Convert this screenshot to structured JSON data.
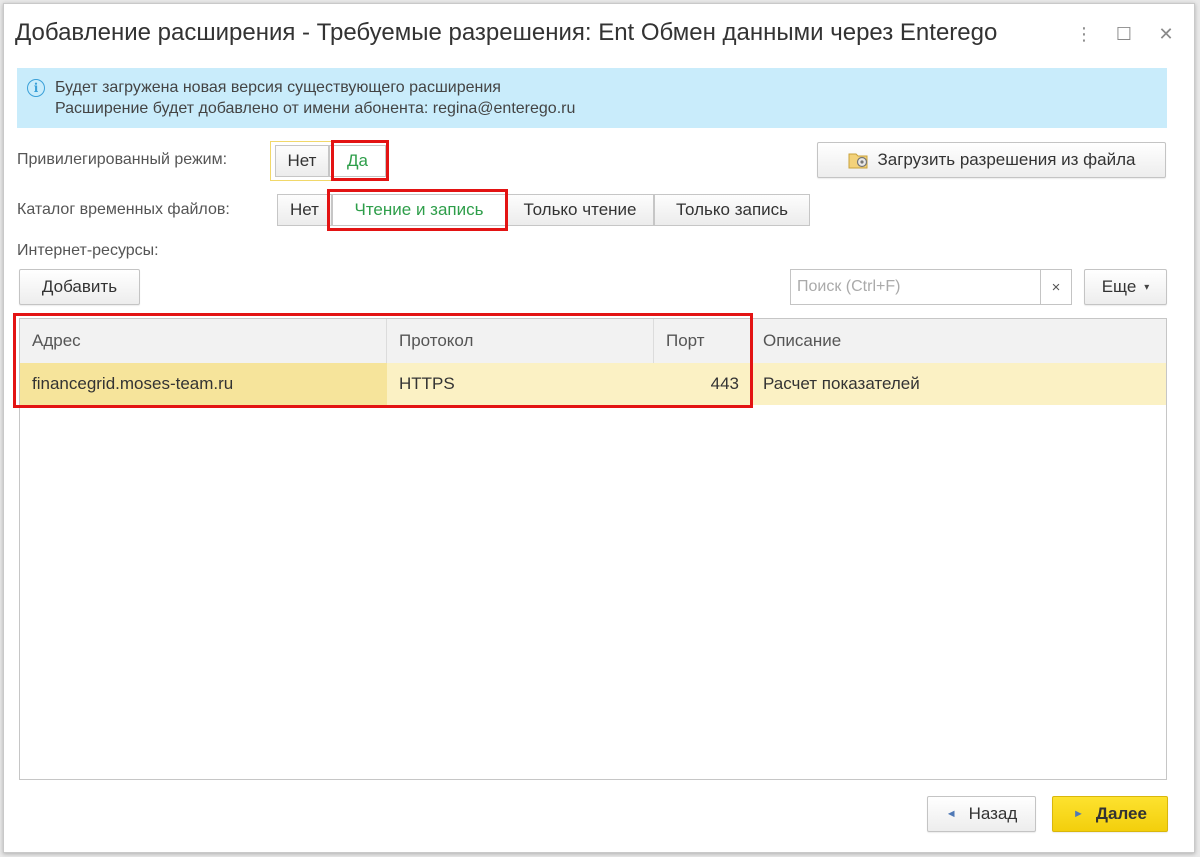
{
  "window": {
    "title": "Добавление расширения - Требуемые разрешения: Ent Обмен данными через Enterego",
    "more_icon": "⋮",
    "maximize_icon": "☐",
    "close_icon": "✕"
  },
  "info": {
    "line1": "Будет загружена новая версия существующего расширения",
    "line2": "Расширение будет добавлено от имени абонента: regina@enterego.ru"
  },
  "privileged": {
    "label": "Привилегированный режим:",
    "options": [
      "Нет",
      "Да"
    ],
    "selected": "Да"
  },
  "load_button": {
    "label": "Загрузить разрешения из файла"
  },
  "temp_catalog": {
    "label": "Каталог временных файлов:",
    "options": [
      "Нет",
      "Чтение и запись",
      "Только чтение",
      "Только запись"
    ],
    "selected": "Чтение и запись"
  },
  "internet": {
    "label": "Интернет-ресурсы:",
    "add_label": "Добавить",
    "search_placeholder": "Поиск (Ctrl+F)",
    "clear_icon": "×",
    "more_label": "Еще",
    "more_caret": "▾"
  },
  "table": {
    "columns": [
      "Адрес",
      "Протокол",
      "Порт",
      "Описание"
    ],
    "rows": [
      {
        "address": "financegrid.moses-team.ru",
        "protocol": "HTTPS",
        "port": "443",
        "description": "Расчет показателей"
      }
    ]
  },
  "footer": {
    "back_label": "Назад",
    "next_label": "Далее",
    "back_icon": "◄",
    "next_icon": "►"
  },
  "colors": {
    "accent_green": "#2e9e4a",
    "highlight_red": "#e31313",
    "info_bg": "#c9ecfb",
    "selected_row": "#fbf1c4",
    "next_button": "#f7d51a"
  }
}
